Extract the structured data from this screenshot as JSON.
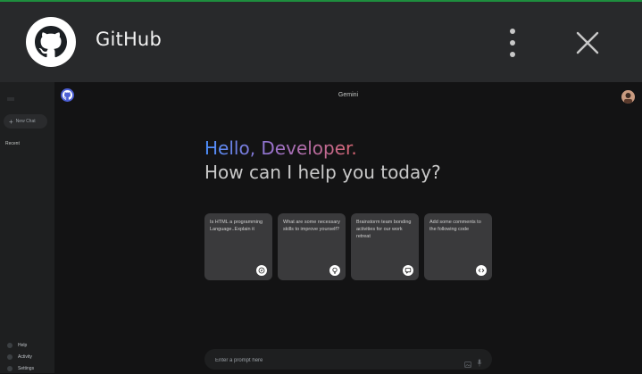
{
  "app": {
    "title": "GitHub"
  },
  "sidebar": {
    "new_chat_label": "New Chat",
    "recent_label": "Recent",
    "bottom_items": [
      {
        "label": "Help"
      },
      {
        "label": "Activity"
      },
      {
        "label": "Settings"
      }
    ]
  },
  "main": {
    "title": "Gemini",
    "greeting": "Hello, Developer.",
    "subtitle": "How can I help you today?",
    "cards": [
      {
        "text": "Is HTML a programming Language..Explain it",
        "icon": "compass-icon"
      },
      {
        "text": "What are some necessary skills to improve yourself?",
        "icon": "bulb-icon"
      },
      {
        "text": "Brainstorm team bonding activities for our work retreat",
        "icon": "message-icon"
      },
      {
        "text": "Add some comments to the following code",
        "icon": "code-icon"
      }
    ],
    "prompt": {
      "placeholder": "Enter a prompt here"
    }
  },
  "colors": {
    "accent": "#1e8e3e",
    "gradient": [
      "#4b90ff",
      "#9b72cb",
      "#d96570"
    ]
  }
}
